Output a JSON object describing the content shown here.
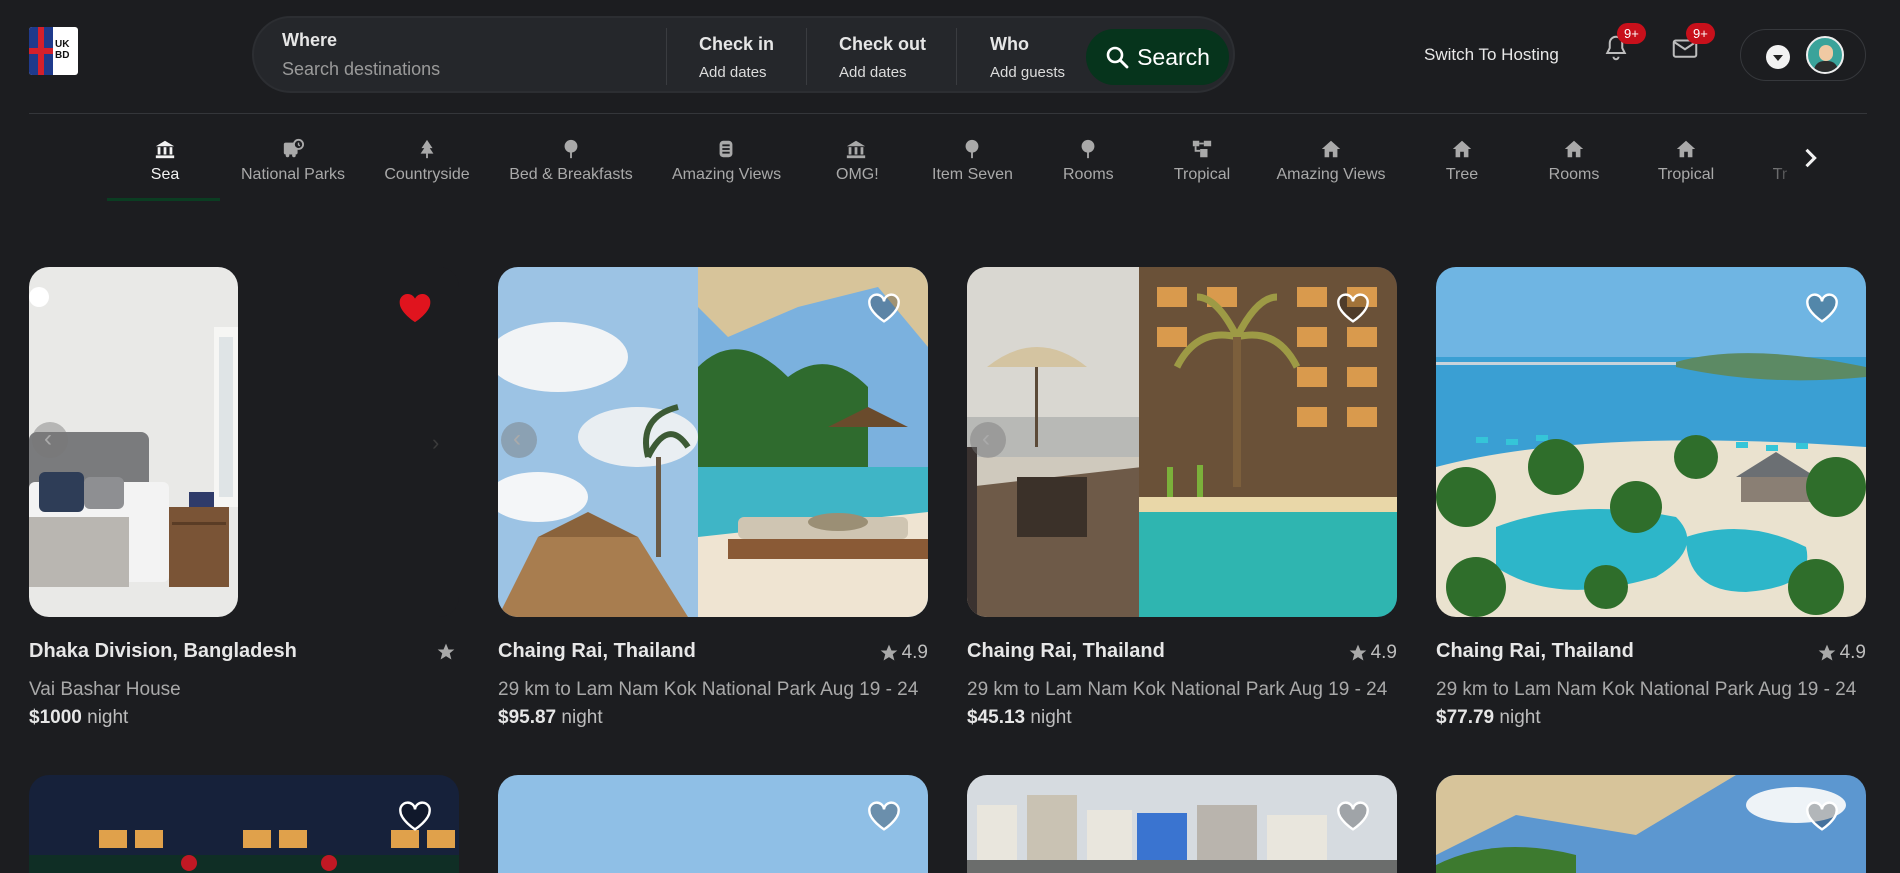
{
  "logo": {
    "text": "UK\nBD"
  },
  "search": {
    "where_label": "Where",
    "where_placeholder": "Search destinations",
    "checkin_label": "Check in",
    "checkin_value": "Add dates",
    "checkout_label": "Check out",
    "checkout_value": "Add dates",
    "who_label": "Who",
    "who_value": "Add guests",
    "button_label": "Search"
  },
  "header": {
    "switch_label": "Switch To Hosting",
    "notifications_badge": "9+",
    "messages_badge": "9+"
  },
  "categories": [
    {
      "label": "Sea",
      "icon": "bank-icon",
      "active": true
    },
    {
      "label": "National Parks",
      "icon": "bus-icon"
    },
    {
      "label": "Countryside",
      "icon": "tree-icon"
    },
    {
      "label": "Bed & Breakfasts",
      "icon": "pin-icon"
    },
    {
      "label": "Amazing Views",
      "icon": "tower-icon"
    },
    {
      "label": "OMG!",
      "icon": "bank-icon"
    },
    {
      "label": "Item Seven",
      "icon": "pin-icon"
    },
    {
      "label": "Rooms",
      "icon": "pin-icon"
    },
    {
      "label": "Tropical",
      "icon": "blocks-icon"
    },
    {
      "label": "Amazing Views",
      "icon": "home-icon"
    },
    {
      "label": "Tree",
      "icon": "home-icon"
    },
    {
      "label": "Rooms",
      "icon": "home-icon"
    },
    {
      "label": "Tropical",
      "icon": "home-icon"
    },
    {
      "label": "Tr",
      "icon": ""
    }
  ],
  "listings": [
    {
      "title": "Dhaka Division, Bangladesh",
      "rating": "",
      "subtitle": "Vai Bashar House",
      "price": "$1000",
      "unit": "night",
      "liked": true
    },
    {
      "title": "Chaing Rai, Thailand",
      "rating": "4.9",
      "subtitle": "29 km to Lam Nam Kok National Park Aug 19 - 24",
      "price": "$95.87",
      "unit": "night",
      "liked": false
    },
    {
      "title": "Chaing Rai, Thailand",
      "rating": "4.9",
      "subtitle": "29 km to Lam Nam Kok National Park Aug 19 - 24",
      "price": "$45.13",
      "unit": "night",
      "liked": false
    },
    {
      "title": "Chaing Rai, Thailand",
      "rating": "4.9",
      "subtitle": "29 km to Lam Nam Kok National Park Aug 19 - 24",
      "price": "$77.79",
      "unit": "night",
      "liked": false
    }
  ],
  "colors": {
    "accent": "#06341c",
    "badge": "#c8101b",
    "liked": "#e0141e"
  }
}
